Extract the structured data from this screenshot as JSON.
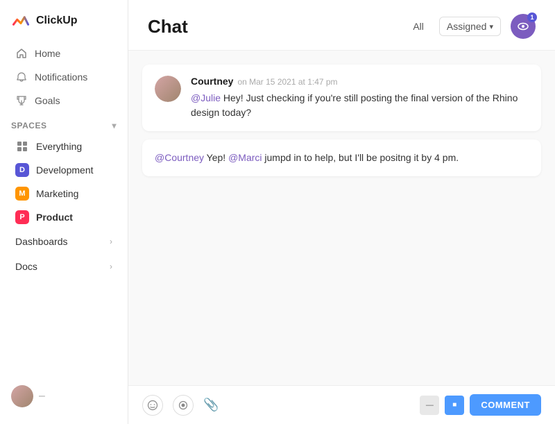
{
  "logo": {
    "text": "ClickUp"
  },
  "sidebar": {
    "nav": [
      {
        "id": "home",
        "label": "Home",
        "icon": "🏠"
      },
      {
        "id": "notifications",
        "label": "Notifications",
        "icon": "🔔"
      },
      {
        "id": "goals",
        "label": "Goals",
        "icon": "🏆"
      }
    ],
    "spaces_label": "Spaces",
    "spaces": [
      {
        "id": "everything",
        "label": "Everything",
        "type": "grid"
      },
      {
        "id": "development",
        "label": "Development",
        "type": "badge",
        "badge_text": "D",
        "badge_class": "badge-dev"
      },
      {
        "id": "marketing",
        "label": "Marketing",
        "type": "badge",
        "badge_text": "M",
        "badge_class": "badge-mkt"
      },
      {
        "id": "product",
        "label": "Product",
        "type": "badge",
        "badge_text": "P",
        "badge_class": "badge-prod",
        "bold": true
      }
    ],
    "expandables": [
      {
        "id": "dashboards",
        "label": "Dashboards"
      },
      {
        "id": "docs",
        "label": "Docs"
      }
    ]
  },
  "header": {
    "title": "Chat",
    "filter_all": "All",
    "filter_assigned": "Assigned",
    "eye_badge": "1"
  },
  "messages": [
    {
      "id": "msg1",
      "author": "Courtney",
      "time": "on Mar 15 2021 at 1:47 pm",
      "text_parts": [
        {
          "type": "mention",
          "text": "@Julie"
        },
        {
          "type": "text",
          "text": " Hey! Just checking if you're still posting the final version of the Rhino design today?"
        }
      ]
    }
  ],
  "reply": {
    "text_parts": [
      {
        "type": "mention",
        "text": "@Courtney"
      },
      {
        "type": "text",
        "text": " Yep! "
      },
      {
        "type": "mention",
        "text": "@Marci"
      },
      {
        "type": "text",
        "text": " jumpd in to help, but I'll be positng it by 4 pm."
      }
    ]
  },
  "input_area": {
    "comment_btn": "COMMENT"
  }
}
